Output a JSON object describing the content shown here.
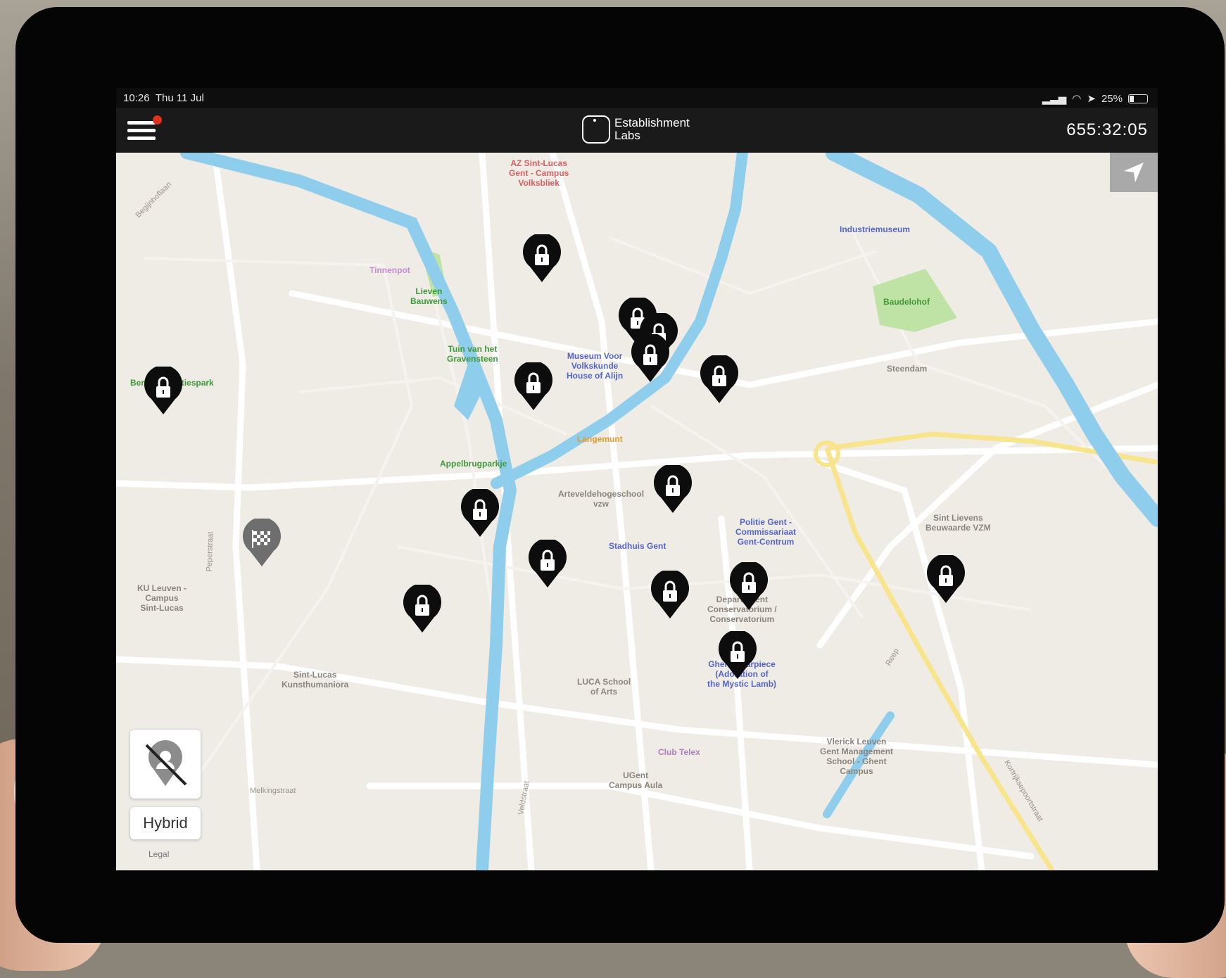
{
  "status_bar": {
    "time": "10:26",
    "date": "Thu 11 Jul",
    "battery": "25%"
  },
  "app_bar": {
    "brand_line1": "Establishment",
    "brand_line2": "Labs",
    "timer": "655:32:05"
  },
  "map": {
    "mode_button": "Hybrid",
    "legal_label": "Legal",
    "colors": {
      "land": "#efece6",
      "water": "#8fcdec",
      "park": "#bfe3a4",
      "pin": "#0d0d0d",
      "finish_pin": "#6e6e6e",
      "locate_button": "#a9a9a9"
    },
    "labels": {
      "az": "AZ Sint-Lucas\nGent - Campus\nVolksbliek",
      "tinnenpot": "Tinnenpot",
      "lieven": "Lieven\nBauwens",
      "industriemuseum": "Industriemuseum",
      "baudelohof": "Baudelohof",
      "tuin": "Tuin van het\nGravensteen",
      "museum": "Museum Voor\nVolkskunde\nHouse of Alijn",
      "bernadettes": "Bernadettes’tiespark",
      "steendam": "Steendam",
      "langemunt": "Langemunt",
      "appelbrug": "Appelbrugparkje",
      "artevelde": "Arteveldehogeschool\nvzw",
      "politie": "Politie Gent -\nCommissariaat\nGent-Centrum",
      "stadhuis": "Stadhuis Gent",
      "sint_lievens": "Sint Lievens\nBeuwaarde VZM",
      "ku_leuven": "KU Leuven -\nCampus\nSint-Lucas",
      "conservatorium": "Departement\nConservatorium /\nConservatorium",
      "sint_lucas": "Sint-Lucas\nKunsthumaniora",
      "luca": "LUCA School\nof Arts",
      "ghent_altar": "Ghent Altarpiece\n(Adoration of\nthe Mystic Lamb)",
      "vlerick": "Vlerick Leuven\nGent Management\nSchool - Ghent\nCampus",
      "club_telex": "Club Telex",
      "ugent": "UGent\nCampus Aula",
      "begijnhoflaan": "Begijnhoflaan",
      "peperstraat": "Peperstraat",
      "veldstraat": "Veldstraat",
      "reep": "Reep",
      "kortrijksepoort": "Kortrijksepoortstraat",
      "melkingstraat": "Melkingstraat"
    },
    "pins": [
      "lock-icon",
      "lock-icon",
      "lock-icon",
      "lock-icon",
      "lock-icon",
      "lock-icon",
      "lock-icon",
      "lock-icon",
      "lock-icon",
      "lock-icon",
      "lock-icon",
      "lock-icon",
      "lock-icon",
      "lock-icon",
      "lock-icon"
    ],
    "finish_pin_icon": "checkered-flag-icon",
    "locate_icon": "navigation-arrow-icon",
    "user_icon": "user-location-off-icon"
  }
}
